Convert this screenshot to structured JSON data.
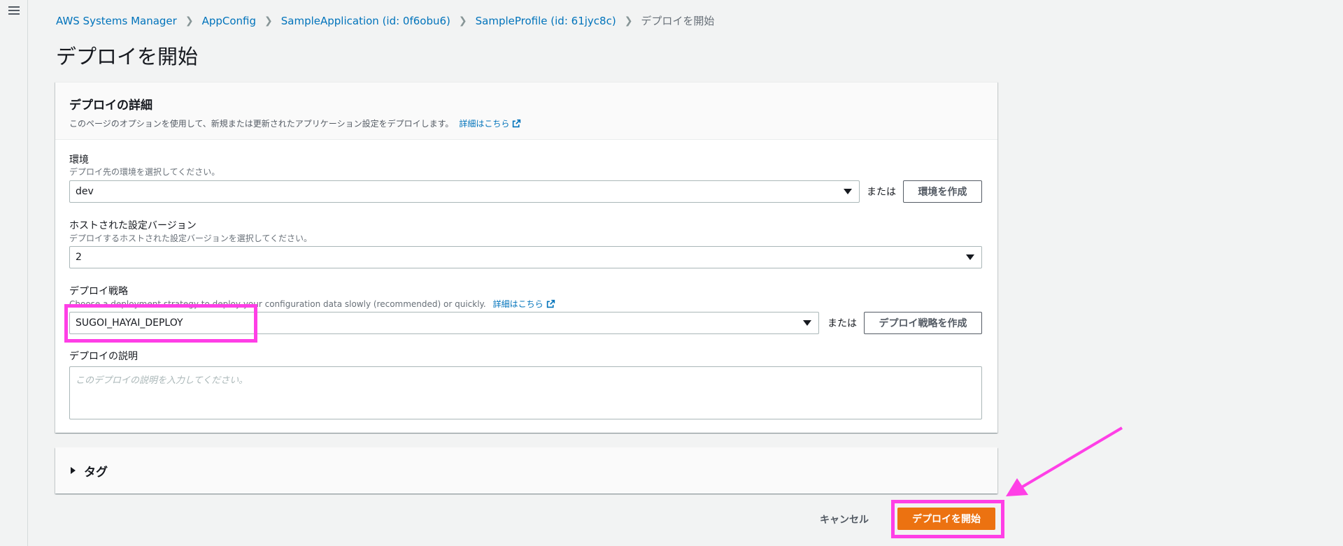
{
  "nav": {
    "menu_icon": "hamburger-menu-icon"
  },
  "breadcrumb": {
    "items": [
      "AWS Systems Manager",
      "AppConfig",
      "SampleApplication (id: 0f6obu6)",
      "SampleProfile (id: 61jyc8c)"
    ],
    "current": "デプロイを開始"
  },
  "page_title": "デプロイを開始",
  "details": {
    "title": "デプロイの詳細",
    "description": "このページのオプションを使用して、新規または更新されたアプリケーション設定をデプロイします。",
    "learn_more": "詳細はこちら"
  },
  "environment": {
    "label": "環境",
    "description": "デプロイ先の環境を選択してください。",
    "value": "dev",
    "or": "または",
    "create_button": "環境を作成"
  },
  "version": {
    "label": "ホストされた設定バージョン",
    "description": "デプロイするホストされた設定バージョンを選択してください。",
    "value": "2"
  },
  "strategy": {
    "label": "デプロイ戦略",
    "description": "Choose a deployment strategy to deploy your configuration data slowly (recommended) or quickly.",
    "learn_more": "詳細はこちら",
    "value": "SUGOI_HAYAI_DEPLOY",
    "or": "または",
    "create_button": "デプロイ戦略を作成"
  },
  "deploy_description": {
    "label": "デプロイの説明",
    "placeholder": "このデプロイの説明を入力してください。"
  },
  "tags": {
    "title": "タグ"
  },
  "actions": {
    "cancel": "キャンセル",
    "start": "デプロイを開始"
  },
  "colors": {
    "primary": "#ec7211",
    "link": "#0073bb",
    "highlight": "#ff3fe6"
  }
}
